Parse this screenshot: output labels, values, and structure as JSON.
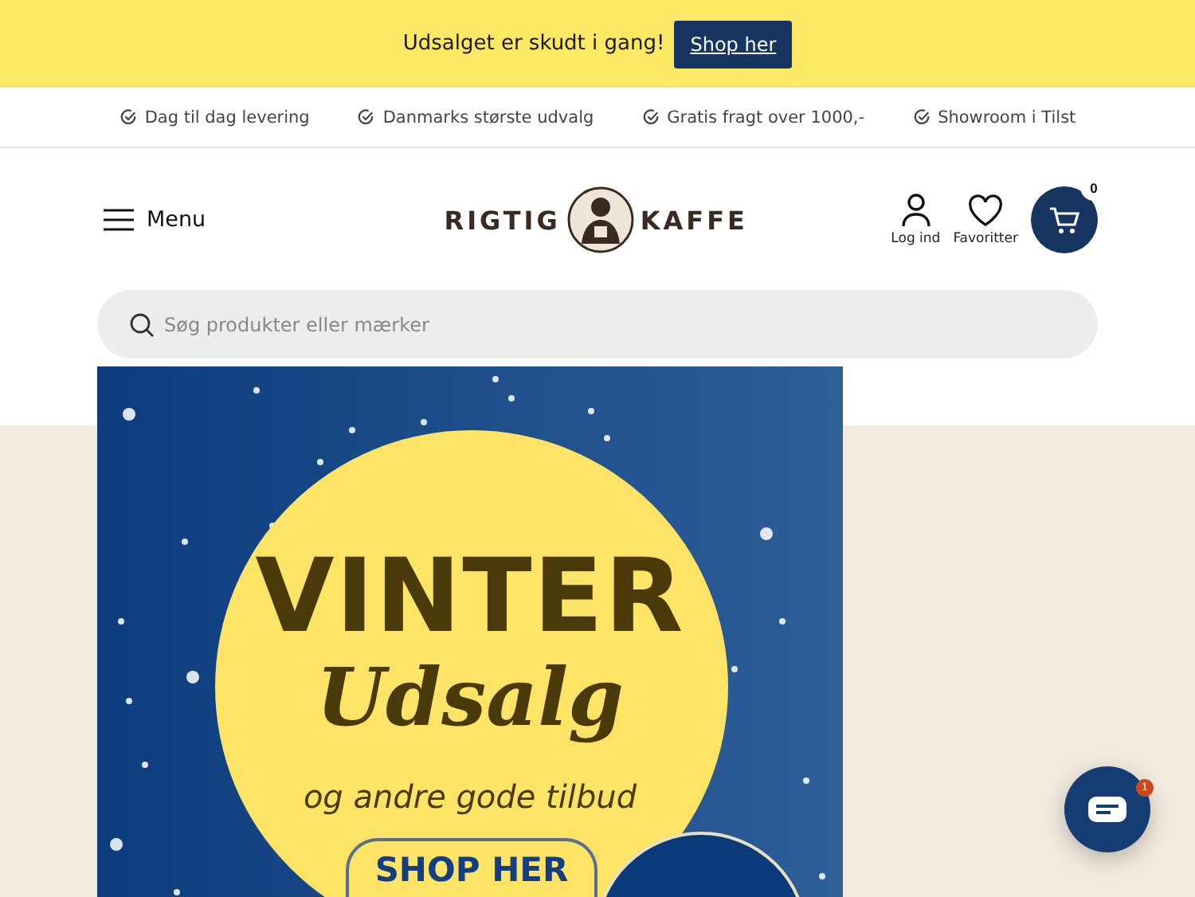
{
  "promo_bar": {
    "text": "Udsalget er skudt i gang!",
    "button": "Shop her"
  },
  "usp_bar": [
    "Dag til dag levering",
    "Danmarks største udvalg",
    "Gratis fragt over 1000,-",
    "Showroom i Tilst"
  ],
  "header": {
    "menu": "Menu",
    "logo_left": "RIGTIG",
    "logo_right": "KAFFE",
    "login": "Log ind",
    "favorites": "Favoritter",
    "cart_count": "0"
  },
  "search": {
    "placeholder": "Søg produkter eller mærker"
  },
  "hero_banner": {
    "headline": "VINTER",
    "script": "Udsalg",
    "subline": "og andre gode tilbud",
    "button": "SHOP HER"
  },
  "chat": {
    "badge": "1"
  }
}
